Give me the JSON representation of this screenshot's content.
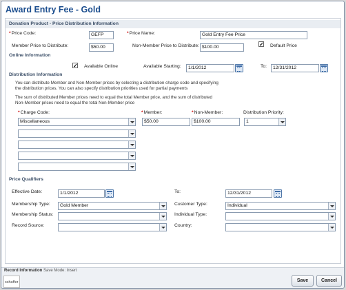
{
  "window": {
    "title": "Award Entry Fee - Gold"
  },
  "sections": {
    "donation": "Donation Product - Price Distribution Information",
    "online": "Online Information",
    "distribution": "Distribution Information",
    "qualifiers": "Price Qualifiers"
  },
  "donation": {
    "price_code_label": "Price Code:",
    "price_code_value": "GEFP",
    "price_name_label": "Price Name:",
    "price_name_value": "Gold Entry Fee Price",
    "member_price_label": "Member Price to Distribute:",
    "member_price_value": "$50.00",
    "nonmember_price_label": "Non-Member Price to Distribute:",
    "nonmember_price_value": "$100.00",
    "default_price_label": "Default Price",
    "default_price_checked": true
  },
  "online": {
    "available_online_label": "Available Online",
    "available_online_checked": true,
    "available_starting_label": "Available Starting:",
    "available_starting_value": "1/1/2012",
    "to_label": "To:",
    "to_value": "12/31/2012"
  },
  "distribution": {
    "note1": "You can distribute Member and Non-Member prices by selecting a distribution charge code and specifying the distribution prices. You can also specify distribution priorities used for partial payments",
    "note2": "The sum of distributed Member prices need to equal the total Member price, and the sum of distributed Non-Member prices need to equal the total Non-Member price",
    "charge_code_label": "Charge Code:",
    "member_label": "Member:",
    "nonmember_label": "Non-Member:",
    "priority_label": "Distribution Priority:",
    "rows": [
      {
        "charge_code": "Miscellaneous",
        "member": "$50.00",
        "nonmember": "$100.00",
        "priority": "1"
      },
      {
        "charge_code": ""
      },
      {
        "charge_code": ""
      },
      {
        "charge_code": ""
      },
      {
        "charge_code": ""
      }
    ]
  },
  "qualifiers": {
    "effective_date_label": "Effective Date:",
    "effective_date_value": "1/1/2012",
    "to_label": "To:",
    "to_value": "12/31/2012",
    "membership_type_label": "Membership Type:",
    "membership_type_value": "Gold Member",
    "customer_type_label": "Customer Type:",
    "customer_type_value": "Individual",
    "membership_status_label": "Membership Status:",
    "membership_status_value": "",
    "individual_type_label": "Individual Type:",
    "individual_type_value": "",
    "record_source_label": "Record Source:",
    "record_source_value": "",
    "country_label": "Country:",
    "country_value": ""
  },
  "footer": {
    "record_info_label": "Record Information",
    "save_mode": "Save Mode: Insert",
    "user": "sshaffer",
    "save_button": "Save",
    "cancel_button": "Cancel"
  }
}
